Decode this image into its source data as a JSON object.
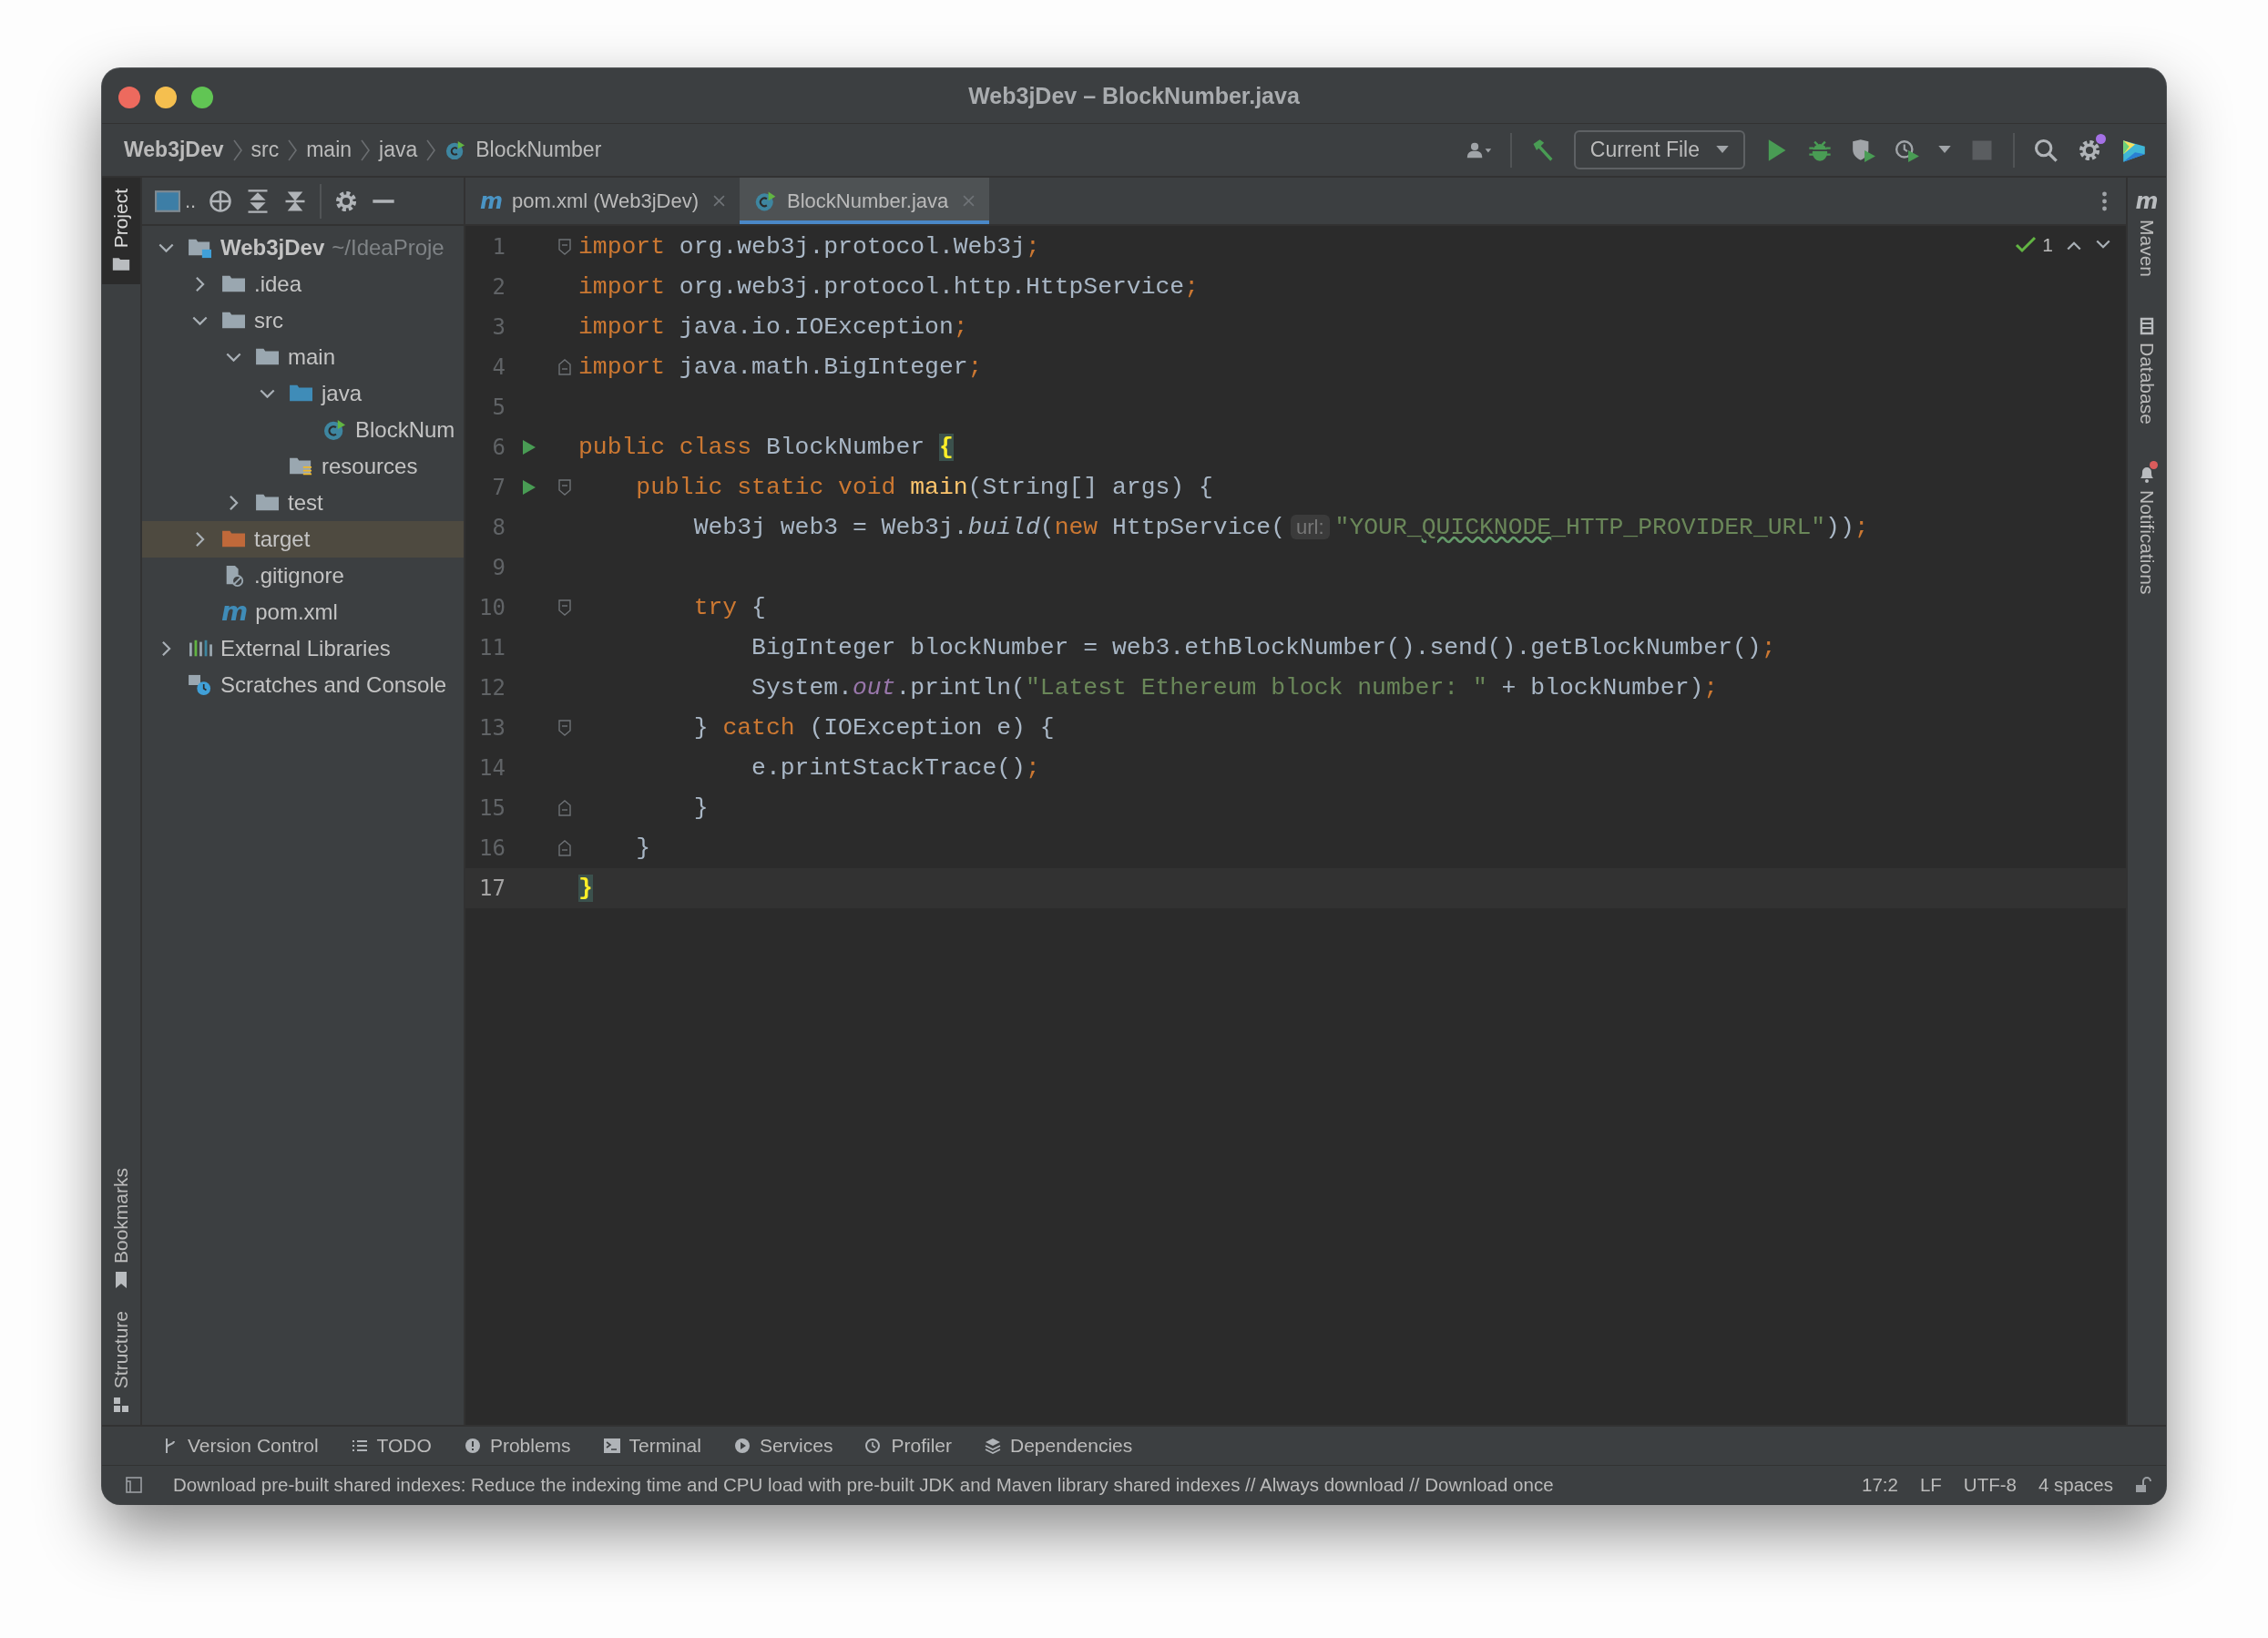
{
  "window": {
    "title": "Web3jDev – BlockNumber.java"
  },
  "navbar": {
    "breadcrumbs": [
      "Web3jDev",
      "src",
      "main",
      "java",
      "BlockNumber"
    ],
    "run_config": "Current File",
    "settings_badge": true
  },
  "left_stripe": {
    "top": [
      {
        "label": "Project",
        "selected": true
      }
    ],
    "bottom": [
      {
        "label": "Bookmarks",
        "selected": false
      },
      {
        "label": "Structure",
        "selected": false
      }
    ]
  },
  "right_stripe": [
    {
      "label": "Maven",
      "icon_letter": "m",
      "badge": false
    },
    {
      "label": "Database",
      "badge": false
    },
    {
      "label": "Notifications",
      "badge": true
    }
  ],
  "project": {
    "view_label": "..",
    "tree": [
      {
        "label": "Web3jDev",
        "suffix": "~/IdeaProje",
        "kind": "module",
        "expanded": true,
        "selected": false,
        "children": [
          {
            "label": ".idea",
            "kind": "folder",
            "expanded": false,
            "selected": false
          },
          {
            "label": "src",
            "kind": "folder",
            "expanded": true,
            "selected": false,
            "children": [
              {
                "label": "main",
                "kind": "folder",
                "expanded": true,
                "selected": false,
                "children": [
                  {
                    "label": "java",
                    "kind": "sources",
                    "expanded": true,
                    "selected": false,
                    "children": [
                      {
                        "label": "BlockNum",
                        "kind": "class",
                        "selected": false
                      }
                    ]
                  },
                  {
                    "label": "resources",
                    "kind": "resources",
                    "selected": false
                  }
                ]
              },
              {
                "label": "test",
                "kind": "folder",
                "expanded": false,
                "selected": false
              }
            ]
          },
          {
            "label": "target",
            "kind": "excluded",
            "expanded": false,
            "selected": true
          },
          {
            "label": ".gitignore",
            "kind": "ignore",
            "selected": false
          },
          {
            "label": "pom.xml",
            "kind": "maven",
            "icon_letter": "m",
            "selected": false
          }
        ]
      },
      {
        "label": "External Libraries",
        "kind": "libraries",
        "expanded": false,
        "selected": false
      },
      {
        "label": "Scratches and Console",
        "kind": "scratches",
        "selected": false
      }
    ]
  },
  "tabs": [
    {
      "label": "pom.xml (Web3jDev)",
      "kind": "maven",
      "icon_letter": "m",
      "selected": false
    },
    {
      "label": "BlockNumber.java",
      "kind": "class",
      "selected": true
    }
  ],
  "inspection": {
    "count": "1"
  },
  "code": [
    {
      "number": "1",
      "run": false,
      "current": false,
      "fold_start": true,
      "fold_end": false,
      "tokens": [
        {
          "kind": "kw",
          "text": "import"
        },
        {
          "kind": "plain",
          "text": " org.web3j.protocol.Web3j"
        },
        {
          "kind": "punct",
          "text": ";"
        }
      ]
    },
    {
      "number": "2",
      "run": false,
      "current": false,
      "fold_start": false,
      "fold_end": false,
      "tokens": [
        {
          "kind": "kw",
          "text": "import"
        },
        {
          "kind": "plain",
          "text": " org.web3j.protocol.http.HttpService"
        },
        {
          "kind": "punct",
          "text": ";"
        }
      ]
    },
    {
      "number": "3",
      "run": false,
      "current": false,
      "fold_start": false,
      "fold_end": false,
      "tokens": [
        {
          "kind": "kw",
          "text": "import"
        },
        {
          "kind": "plain",
          "text": " java.io.IOException"
        },
        {
          "kind": "punct",
          "text": ";"
        }
      ]
    },
    {
      "number": "4",
      "run": false,
      "current": false,
      "fold_start": false,
      "fold_end": true,
      "tokens": [
        {
          "kind": "kw",
          "text": "import"
        },
        {
          "kind": "plain",
          "text": " java.math.BigInteger"
        },
        {
          "kind": "punct",
          "text": ";"
        }
      ]
    },
    {
      "number": "5",
      "run": false,
      "current": false,
      "fold_start": false,
      "fold_end": false
    },
    {
      "number": "6",
      "run": true,
      "current": false,
      "fold_start": false,
      "fold_end": false,
      "tokens": [
        {
          "kind": "kw",
          "text": "public class"
        },
        {
          "kind": "plain",
          "text": " BlockNumber"
        },
        {
          "kind": "brace",
          "text": "{"
        }
      ]
    },
    {
      "number": "7",
      "run": true,
      "current": false,
      "fold_start": true,
      "fold_end": false,
      "tokens": [
        {
          "kind": "kw",
          "text": "    public static void"
        },
        {
          "kind": "decl",
          "text": " main"
        },
        {
          "kind": "plain",
          "text": "(String[] args) {"
        }
      ]
    },
    {
      "number": "8",
      "run": false,
      "current": false,
      "fold_start": false,
      "fold_end": false,
      "tokens": [
        {
          "kind": "plain",
          "text": "        Web3j web3 = Web3j."
        },
        {
          "kind": "italic",
          "text": "build"
        },
        {
          "kind": "plain",
          "text": "("
        },
        {
          "kind": "kw",
          "text": "new"
        },
        {
          "kind": "plain",
          "text": " HttpService("
        },
        {
          "kind": "hint",
          "text": "url:"
        },
        {
          "kind": "str",
          "text": "\"YOUR_"
        },
        {
          "kind": "typo",
          "text": "QUICKNODE"
        },
        {
          "kind": "str",
          "text": "_HTTP_PROVIDER_URL\""
        },
        {
          "kind": "plain",
          "text": "))"
        },
        {
          "kind": "punct",
          "text": ";"
        }
      ]
    },
    {
      "number": "9",
      "run": false,
      "current": false,
      "fold_start": false,
      "fold_end": false
    },
    {
      "number": "10",
      "run": false,
      "current": false,
      "fold_start": true,
      "fold_end": false,
      "tokens": [
        {
          "kind": "kw",
          "text": "        try"
        },
        {
          "kind": "plain",
          "text": " {"
        }
      ]
    },
    {
      "number": "11",
      "run": false,
      "current": false,
      "fold_start": false,
      "fold_end": false,
      "tokens": [
        {
          "kind": "plain",
          "text": "            BigInteger blockNumber = web3.ethBlockNumber().send().getBlockNumber()"
        },
        {
          "kind": "punct",
          "text": ";"
        }
      ]
    },
    {
      "number": "12",
      "run": false,
      "current": false,
      "fold_start": false,
      "fold_end": false,
      "tokens": [
        {
          "kind": "plain",
          "text": "            System."
        },
        {
          "kind": "field",
          "text": "out"
        },
        {
          "kind": "plain",
          "text": ".println("
        },
        {
          "kind": "str",
          "text": "\"Latest Ethereum block number: \""
        },
        {
          "kind": "plain",
          "text": " + blockNumber)"
        },
        {
          "kind": "punct",
          "text": ";"
        }
      ]
    },
    {
      "number": "13",
      "run": false,
      "current": false,
      "fold_start": true,
      "fold_end": false,
      "tokens": [
        {
          "kind": "plain",
          "text": "        } "
        },
        {
          "kind": "kw",
          "text": "catch"
        },
        {
          "kind": "plain",
          "text": " (IOException e) {"
        }
      ]
    },
    {
      "number": "14",
      "run": false,
      "current": false,
      "fold_start": false,
      "fold_end": false,
      "tokens": [
        {
          "kind": "plain",
          "text": "            e.printStackTrace()"
        },
        {
          "kind": "punct",
          "text": ";"
        }
      ]
    },
    {
      "number": "15",
      "run": false,
      "current": false,
      "fold_start": false,
      "fold_end": true,
      "tokens": [
        {
          "kind": "plain",
          "text": "        }"
        }
      ]
    },
    {
      "number": "16",
      "run": false,
      "current": false,
      "fold_start": false,
      "fold_end": true,
      "tokens": [
        {
          "kind": "plain",
          "text": "    }"
        }
      ]
    },
    {
      "number": "17",
      "run": false,
      "current": true,
      "fold_start": false,
      "fold_end": false,
      "tokens": [
        {
          "kind": "brace",
          "text": "}"
        }
      ]
    }
  ],
  "tool_windows": [
    "Version Control",
    "TODO",
    "Problems",
    "Terminal",
    "Services",
    "Profiler",
    "Dependencies"
  ],
  "status_bar": {
    "message": "Download pre-built shared indexes: Reduce the indexing time and CPU load with pre-built JDK and Maven library shared indexes // Always download // Download once",
    "position": "17:2",
    "line_separator": "LF",
    "encoding": "UTF-8",
    "indent": "4 spaces"
  }
}
